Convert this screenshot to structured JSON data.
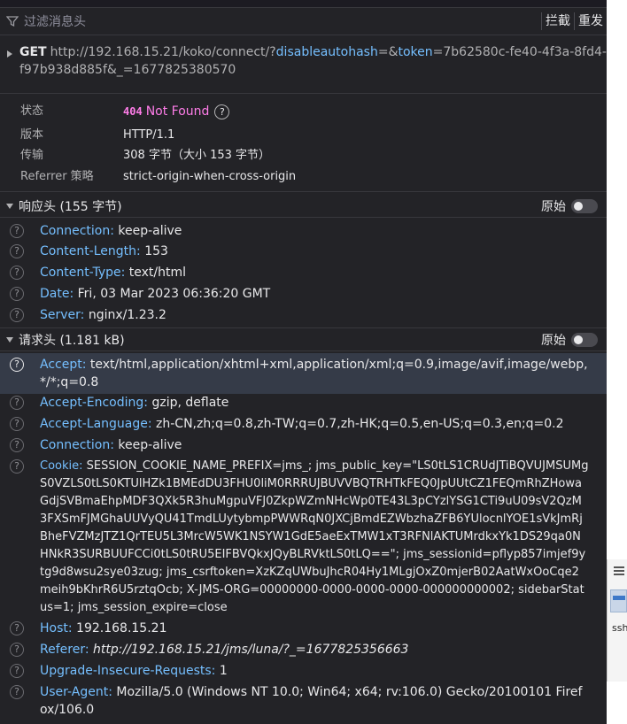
{
  "filter": {
    "placeholder": "过滤消息头",
    "block_label": "拦截",
    "resend_label": "重发"
  },
  "request": {
    "method": "GET",
    "url_prefix": "http://192.168.15.21/koko/connect/?",
    "p1_name": "disableautohash",
    "p1_rest": "=&",
    "p2_name": "token",
    "p2_rest": "=7b62580c-fe40-4f3a-8fd4-f97b938d885f&_=1677825380570"
  },
  "summary": {
    "status_label": "状态",
    "status_code": "404",
    "status_text": "Not Found",
    "version_label": "版本",
    "version_value": "HTTP/1.1",
    "transfer_label": "传输",
    "transfer_value": "308 字节（大小 153 字节）",
    "referrer_label": "Referrer 策略",
    "referrer_value": "strict-origin-when-cross-origin"
  },
  "response_headers": {
    "title": "响应头 (155 字节)",
    "raw_label": "原始",
    "items": [
      {
        "name": "Connection:",
        "value": "keep-alive"
      },
      {
        "name": "Content-Length:",
        "value": "153"
      },
      {
        "name": "Content-Type:",
        "value": "text/html"
      },
      {
        "name": "Date:",
        "value": "Fri, 03 Mar 2023 06:36:20 GMT"
      },
      {
        "name": "Server:",
        "value": "nginx/1.23.2"
      }
    ]
  },
  "request_headers": {
    "title": "请求头 (1.181 kB)",
    "raw_label": "原始",
    "items": [
      {
        "name": "Accept:",
        "value": "text/html,application/xhtml+xml,application/xml;q=0.9,image/avif,image/webp,*/*;q=0.8"
      },
      {
        "name": "Accept-Encoding:",
        "value": "gzip, deflate"
      },
      {
        "name": "Accept-Language:",
        "value": "zh-CN,zh;q=0.8,zh-TW;q=0.7,zh-HK;q=0.5,en-US;q=0.3,en;q=0.2"
      },
      {
        "name": "Connection:",
        "value": "keep-alive"
      },
      {
        "name": "Cookie:",
        "value": "SESSION_COOKIE_NAME_PREFIX=jms_; jms_public_key=\"LS0tLS1CRUdJTiBQVUJMSUMgS0VZLS0tLS0KTUlHZk1BMEdDU3FHU0liM0RRRUJBUVVBQTRHTkFEQ0JpUUtCZ1FEQmRhZHowaGdjSVBmaEhpMDF3QXk5R3huMgpuVFJ0ZkpWZmNHcWp0TE43L3pCYzlYSG1CTi9uU09sV2QzM3FXSmFJMGhaUUVyQU41TmdLUytybmpPWWRqN0JXCjBmdEZWbzhaZFB6YUlocnlYOE1sVkJmRjBheFVZMzJTZ1QrTEU5L3MrcW5WK1NSYW1GdE5aeExTMW1xT3RFNlAKTUMrdkxYk1DS29qa0NHNkR3SURBUUFCCi0tLS0tRU5EIFBVQkxJQyBLRVktLS0tLQ==\"; jms_sessionid=pflyp857imjef9ytg9d8wsu2sye03zug; jms_csrftoken=XzKZqUWbuJhcR04Hy1MLgjOxZ0mjerB02AatWxOoCqe2meih9bKhrR6U5rztqOcb; X-JMS-ORG=00000000-0000-0000-0000-000000000002; sidebarStatus=1; jms_session_expire=close"
      },
      {
        "name": "Host:",
        "value": "192.168.15.21"
      },
      {
        "name": "Referer:",
        "value": "http://192.168.15.21/jms/luna/?_=1677825356663"
      },
      {
        "name": "Upgrade-Insecure-Requests:",
        "value": "1"
      },
      {
        "name": "User-Agent:",
        "value": "Mozilla/5.0 (Windows NT 10.0; Win64; x64; rv:106.0) Gecko/20100101 Firefox/106.0"
      }
    ]
  },
  "side_strip": {
    "label": "ssh"
  },
  "colors": {
    "background": "#232327",
    "header_name": "#75bfff",
    "status_404": "#ff7de9",
    "selected_row": "#353b48"
  }
}
